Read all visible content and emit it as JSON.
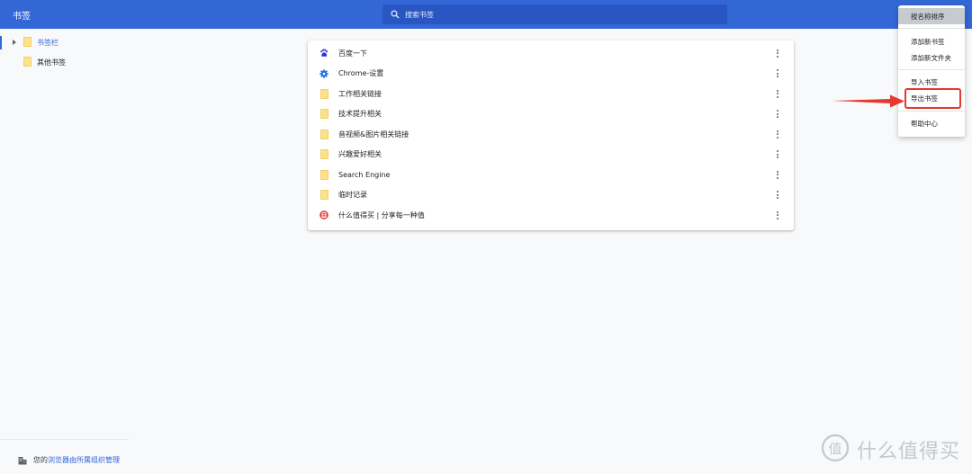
{
  "header": {
    "title": "书签",
    "search_placeholder": "搜索书签",
    "bg_color": "#3367d6"
  },
  "sidebar": {
    "items": [
      {
        "label": "书签栏",
        "active": true,
        "icon": "folder-icon"
      },
      {
        "label": "其他书签",
        "active": false,
        "icon": "folder-icon"
      }
    ],
    "managed_prefix": "您的",
    "managed_link": "浏览器由所属组织管理"
  },
  "bookmarks": [
    {
      "label": "百度一下",
      "icon": "baidu-paw-icon"
    },
    {
      "label": "Chrome-设置",
      "icon": "gear-icon"
    },
    {
      "label": "工作相关链接",
      "icon": "folder-icon"
    },
    {
      "label": "技术提升相关",
      "icon": "folder-icon"
    },
    {
      "label": "音视频&图片相关链接",
      "icon": "folder-icon"
    },
    {
      "label": "兴趣爱好相关",
      "icon": "folder-icon"
    },
    {
      "label": "Search Engine",
      "icon": "folder-icon"
    },
    {
      "label": "临时记录",
      "icon": "folder-icon"
    },
    {
      "label": "什么值得买 | 分享每一种值",
      "icon": "smzdm-icon"
    }
  ],
  "menu": {
    "items": [
      {
        "label": "按名称排序",
        "hover": true
      },
      {
        "label": "添加新书签"
      },
      {
        "label": "添加新文件夹"
      },
      {
        "label": "导入书签"
      },
      {
        "label": "导出书签",
        "highlighted": true
      },
      {
        "label": "帮助中心"
      }
    ]
  },
  "watermark": {
    "text": "什么值得买",
    "logo": "值"
  },
  "colors": {
    "accent": "#3367d6",
    "folder": "#fce28a",
    "highlight": "#e5382f"
  }
}
